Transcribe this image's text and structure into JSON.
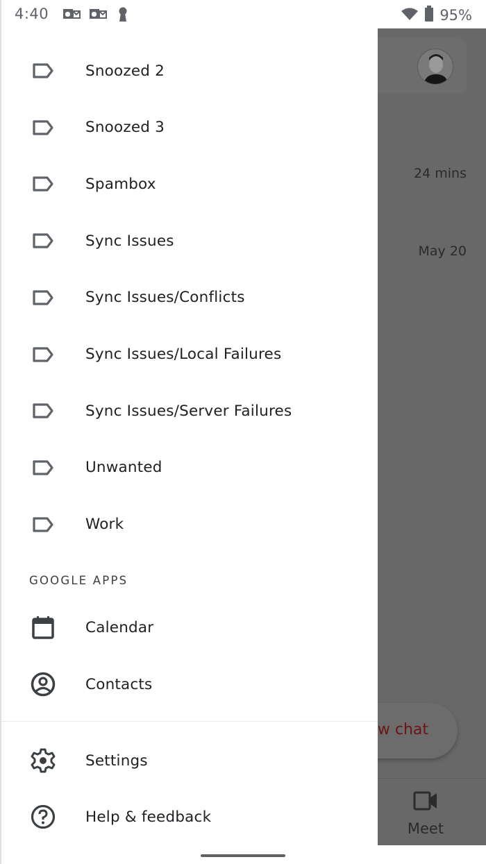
{
  "status_bar": {
    "time": "4:40",
    "notification_icons": [
      "outlook-icon",
      "outlook-icon",
      "keyhole-icon"
    ],
    "wifi": "wifi-icon",
    "battery_icon": "battery-icon",
    "battery_percent": "95%"
  },
  "background_app": {
    "email_times": [
      "24 mins",
      "May 20"
    ],
    "fab_label": "w chat",
    "bottom_nav": {
      "meet_label": "Meet"
    }
  },
  "drawer": {
    "labels": [
      {
        "label": "Snoozed 2",
        "icon": "label-icon"
      },
      {
        "label": "Snoozed 3",
        "icon": "label-icon"
      },
      {
        "label": "Spambox",
        "icon": "label-icon"
      },
      {
        "label": "Sync Issues",
        "icon": "label-icon"
      },
      {
        "label": "Sync Issues/Conflicts",
        "icon": "label-icon"
      },
      {
        "label": "Sync Issues/Local Failures",
        "icon": "label-icon"
      },
      {
        "label": "Sync Issues/Server Failures",
        "icon": "label-icon"
      },
      {
        "label": "Unwanted",
        "icon": "label-icon"
      },
      {
        "label": "Work",
        "icon": "label-icon"
      }
    ],
    "google_apps_header": "GOOGLE APPS",
    "google_apps": [
      {
        "label": "Calendar",
        "icon": "calendar-icon"
      },
      {
        "label": "Contacts",
        "icon": "contacts-icon"
      }
    ],
    "footer": [
      {
        "label": "Settings",
        "icon": "gear-icon"
      },
      {
        "label": "Help & feedback",
        "icon": "help-icon"
      }
    ]
  },
  "colors": {
    "text": "#202124",
    "icon": "#5f6368",
    "scrim": "#686868",
    "fab_text": "#6b1616"
  }
}
